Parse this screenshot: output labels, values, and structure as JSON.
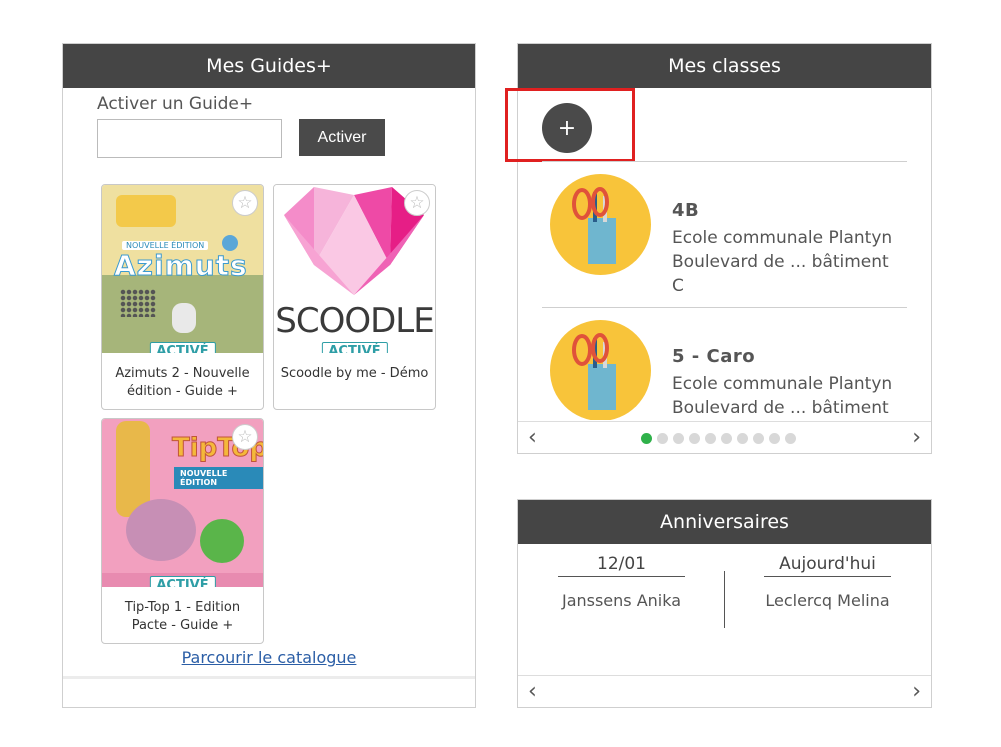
{
  "guides": {
    "title": "Mes Guides+",
    "activate_label": "Activer un Guide+",
    "activate_value": "",
    "activate_button": "Activer",
    "items": [
      {
        "title": "Azimuts 2 - Nouvelle édition - Guide +",
        "badge": "ACTIVÉ",
        "cover_text": "Azimuts",
        "cover_sub": "NOUVELLE ÉDITION"
      },
      {
        "title": "Scoodle by me - Démo",
        "badge": "ACTIVÉ",
        "cover_text": "SCOODLE"
      },
      {
        "title": "Tip-Top 1 - Edition Pacte - Guide +",
        "badge": "ACTIVÉ",
        "cover_text": "TipTop",
        "cover_sub": "NOUVELLE ÉDITION"
      }
    ],
    "catalog_link": "Parcourir le catalogue"
  },
  "classes": {
    "title": "Mes classes",
    "add_button": "+",
    "items": [
      {
        "name": "4B",
        "school": "Ecole communale Plantyn Boulevard de ... bâtiment C"
      },
      {
        "name": "5 - Caro",
        "school": "Ecole communale Plantyn Boulevard de ... bâtiment"
      }
    ],
    "pager": {
      "total": 10,
      "active": 1
    },
    "prev": "‹",
    "next": "›"
  },
  "birthdays": {
    "title": "Anniversaires",
    "entries": [
      {
        "date": "12/01",
        "name": "Janssens Anika"
      },
      {
        "date": "Aujourd'hui",
        "name": "Leclercq Melina"
      }
    ],
    "prev": "‹",
    "next": "›"
  },
  "colors": {
    "header": "#454545",
    "highlight": "#e02020",
    "badge": "#2e9ea6",
    "dot_active": "#2fb14a",
    "icon_bg": "#f8c43a"
  }
}
